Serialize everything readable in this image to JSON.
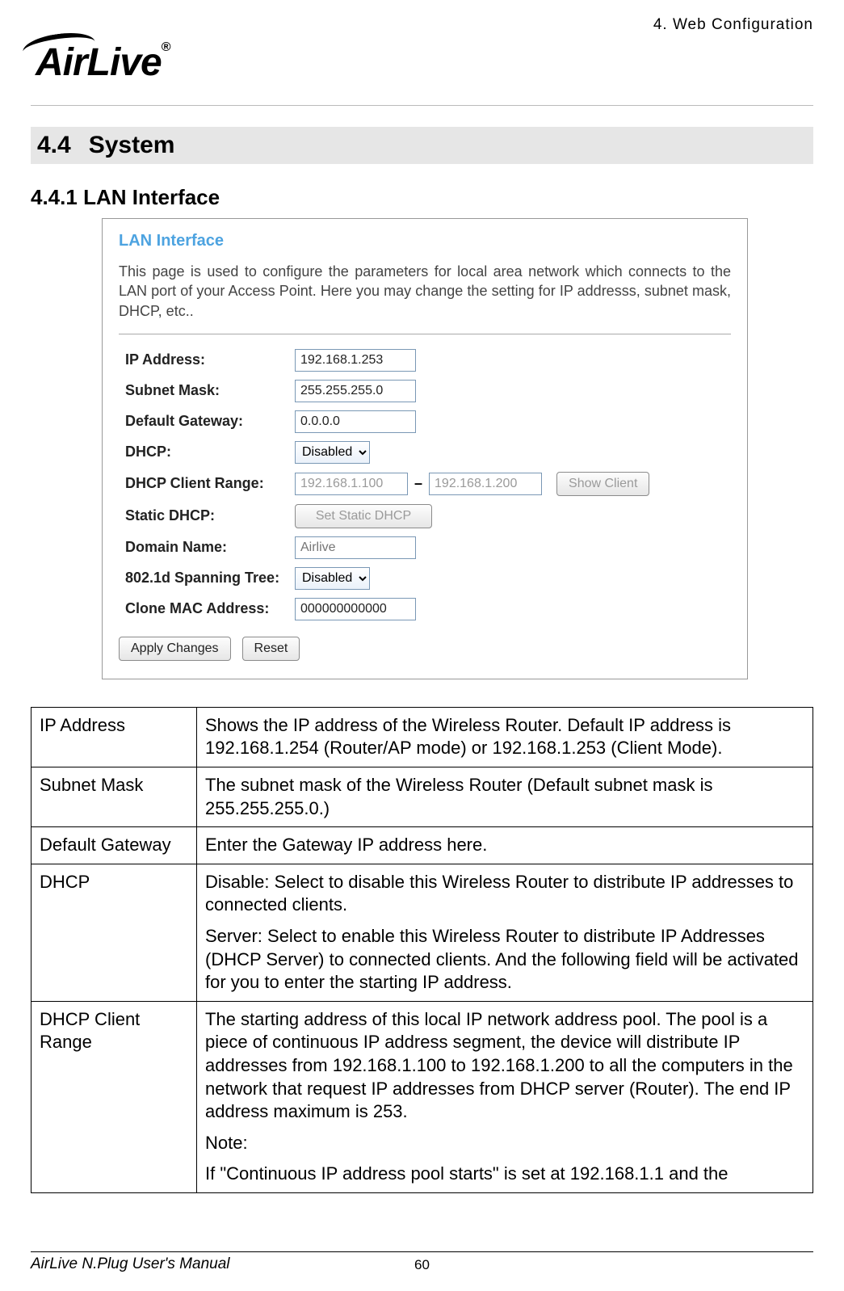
{
  "header": {
    "chapter_ref": "4. Web Configuration",
    "logo_text": "AirLive",
    "logo_reg": "®"
  },
  "section": {
    "number": "4.4",
    "title": "System",
    "sub_number": "4.4.1",
    "sub_title": "LAN Interface"
  },
  "screenshot": {
    "title": "LAN Interface",
    "description": "This page is used to configure the parameters for local area network which connects to the LAN port of your Access Point. Here you may change the setting for IP addresss, subnet mask, DHCP, etc..",
    "fields": {
      "ip_label": "IP Address:",
      "ip_value": "192.168.1.253",
      "subnet_label": "Subnet Mask:",
      "subnet_value": "255.255.255.0",
      "gw_label": "Default Gateway:",
      "gw_value": "0.0.0.0",
      "dhcp_label": "DHCP:",
      "dhcp_value": "Disabled",
      "range_label": "DHCP Client Range:",
      "range_start": "192.168.1.100",
      "range_end": "192.168.1.200",
      "show_client_btn": "Show Client",
      "static_label": "Static DHCP:",
      "static_btn": "Set Static DHCP",
      "domain_label": "Domain Name:",
      "domain_placeholder": "Airlive",
      "stp_label": "802.1d Spanning Tree:",
      "stp_value": "Disabled",
      "clone_label": "Clone MAC Address:",
      "clone_value": "000000000000"
    },
    "actions": {
      "apply": "Apply Changes",
      "reset": "Reset"
    }
  },
  "table": {
    "rows": [
      {
        "k": "IP Address",
        "v": [
          "Shows the IP address of the Wireless Router. Default IP address is 192.168.1.254 (Router/AP mode) or 192.168.1.253 (Client Mode)."
        ]
      },
      {
        "k": "Subnet Mask",
        "v": [
          "The subnet mask of the Wireless Router (Default subnet mask is 255.255.255.0.)"
        ]
      },
      {
        "k": "Default Gateway",
        "v": [
          "Enter the Gateway IP address here."
        ]
      },
      {
        "k": "DHCP",
        "v": [
          "Disable: Select to disable this Wireless Router to distribute IP addresses to connected clients.",
          "Server: Select to enable this Wireless Router to distribute IP Addresses (DHCP Server) to connected clients. And the following field will be activated for you to enter the starting IP address."
        ]
      },
      {
        "k": "DHCP Client Range",
        "v": [
          "The starting address of this local IP network address pool. The pool is a piece of continuous IP address segment, the device will distribute IP addresses from 192.168.1.100 to 192.168.1.200 to all the computers in the network that request IP addresses from DHCP server (Router). The end IP address maximum is 253.",
          "Note:",
          "If \"Continuous IP address pool starts\" is set at 192.168.1.1 and the"
        ]
      }
    ]
  },
  "footer": {
    "manual": "AirLive N.Plug User's Manual",
    "page": "60"
  }
}
